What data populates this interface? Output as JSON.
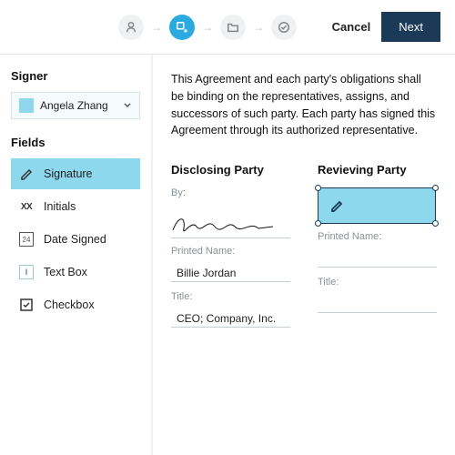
{
  "topbar": {
    "cancel": "Cancel",
    "next": "Next"
  },
  "sidebar": {
    "signer_label": "Signer",
    "signer_name": "Angela Zhang",
    "fields_label": "Fields",
    "fields": [
      {
        "label": "Signature"
      },
      {
        "label": "Initials"
      },
      {
        "label": "Date Signed"
      },
      {
        "label": "Text Box"
      },
      {
        "label": "Checkbox"
      }
    ]
  },
  "document": {
    "agreement_text": "This Agreement and each party's obligations shall be binding on the representatives, assigns, and successors of such party. Each party has signed this Agreement through its authorized representative.",
    "disclosing": {
      "title": "Disclosing Party",
      "by_label": "By:",
      "printed_label": "Printed Name:",
      "printed_value": "Billie Jordan",
      "title_label": "Title:",
      "title_value": "CEO; Company, Inc."
    },
    "reviewing": {
      "title": "Revieving Party",
      "printed_label": "Printed Name:",
      "title_label": "Title:"
    }
  }
}
